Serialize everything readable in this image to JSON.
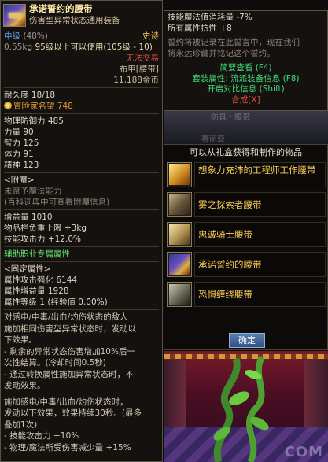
{
  "left": {
    "name": "承诺誓约的腰带",
    "subtitle": "伤害型异常状态通用装备",
    "grade": "中级",
    "grade_pct": "(48%)",
    "rarity": "史诗",
    "weight": "0.55kg",
    "level_req": "95级以上可以使用(105级 - 10)",
    "trade": "无法交易",
    "item_type": "布甲[腰带]",
    "price": "11,188金币",
    "durability": "耐久度 18/18",
    "adventurer_fame": "冒险家名望 748",
    "stats": [
      {
        "label": "物理防御力",
        "value": "485"
      },
      {
        "label": "力量",
        "value": "90"
      },
      {
        "label": "智力",
        "value": "125"
      },
      {
        "label": "体力",
        "value": "91"
      },
      {
        "label": "精神",
        "value": "123"
      }
    ],
    "enchant_title": "<附魔>",
    "enchant_none": "未赋予魔法能力",
    "enchant_hint": "(百科词典中可查看附魔信息)",
    "growth_lines": [
      "增益量 1010",
      "物品栏负重上限 +3kg",
      "技能攻击力 +12.0%"
    ],
    "support_title": "辅助职业专属属性",
    "fixed_title": "<固定属性>",
    "fixed_lines": [
      "属性攻击强化 6144",
      "属性增益量 1928",
      "属性等级 1 (经验值 0.00%)"
    ],
    "desc_a": [
      "对感电/中毒/出血/灼伤状态的敌人",
      "施加相同伤害型异常状态时，发动以",
      "下效果。",
      "- 剩余的异常状态伤害增加10%后一",
      "次性结算。(冷却时间0.5秒)",
      "- 通过转换属性施加异常状态时，不",
      "发动效果。"
    ],
    "desc_b": [
      "施加感电/中毒/出血/灼伤状态时，",
      "发动以下效果，效果持续30秒。(最多",
      "叠加1次)",
      "- 技能攻击力 +10%",
      "- 物理/魔法所受伤害减少量 +15%"
    ]
  },
  "right_top": {
    "mp_cost": "技能魔法值消耗量 -7%",
    "all_res": "所有属性抗性 +8",
    "lore": [
      "誓约将被记录在此誓言中，现在我们",
      "将永远珍藏并铭记这个誓约。"
    ],
    "brief": "简要查看 (F4)",
    "set_info": "套装属性: 流派装备信息 (F8)",
    "compare": "开启对比信息 (Shift)",
    "synthesize": "合成[X]"
  },
  "strip": {
    "ghost_text": "防具・腰带",
    "ghost_text2": "赛丽亚"
  },
  "list": {
    "header": "可以从礼盒获得和制作的物品",
    "items": [
      {
        "label": "想象力充沛的工程师工作腰带",
        "icon": "engineer-belt-icon"
      },
      {
        "label": "雾之探索者腰带",
        "icon": "mist-explorer-belt-icon"
      },
      {
        "label": "忠诚骑士腰带",
        "icon": "loyal-knight-belt-icon"
      },
      {
        "label": "承诺誓约的腰带",
        "icon": "oath-promise-belt-icon"
      },
      {
        "label": "恐惧缠绕腰带",
        "icon": "fear-bound-belt-icon"
      }
    ],
    "confirm": "确定"
  },
  "watermark": "COM",
  "colors": {
    "epic": "#ffd050",
    "untradeable": "#e0503c",
    "green_stat": "#3ee07a",
    "grade_blue": "#5fa0e8",
    "list_label": "#ffcf5a",
    "confirm_btn": "#2f4f80"
  }
}
